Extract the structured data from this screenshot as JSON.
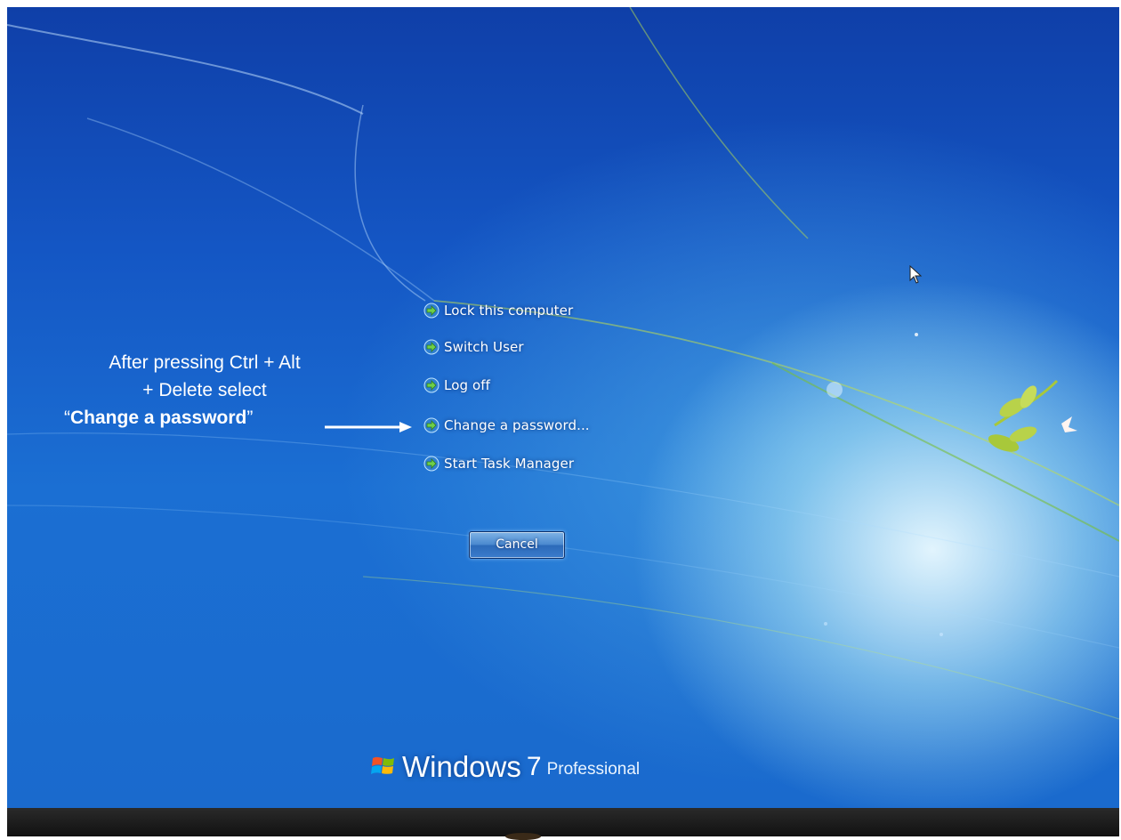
{
  "menu": {
    "items": [
      {
        "label": "Lock this computer"
      },
      {
        "label": "Switch User"
      },
      {
        "label": "Log off"
      },
      {
        "label": "Change a password..."
      },
      {
        "label": "Start Task Manager"
      }
    ],
    "cancel_label": "Cancel"
  },
  "annotation": {
    "line1": "After pressing Ctrl + Alt",
    "line2": "+ Delete select",
    "line3_open_quote": "“",
    "line3_bold": "Change a password",
    "line3_close_quote": "”"
  },
  "branding": {
    "name": "Windows",
    "version": "7",
    "edition": "Professional"
  },
  "colors": {
    "background_blue": "#1456c4",
    "arrow_green": "#5fbf3a",
    "text": "#ffffff"
  },
  "icons": {
    "menu_arrow": "green-right-arrow-icon",
    "logo": "windows-flag-icon",
    "cursor": "mouse-pointer-icon"
  }
}
